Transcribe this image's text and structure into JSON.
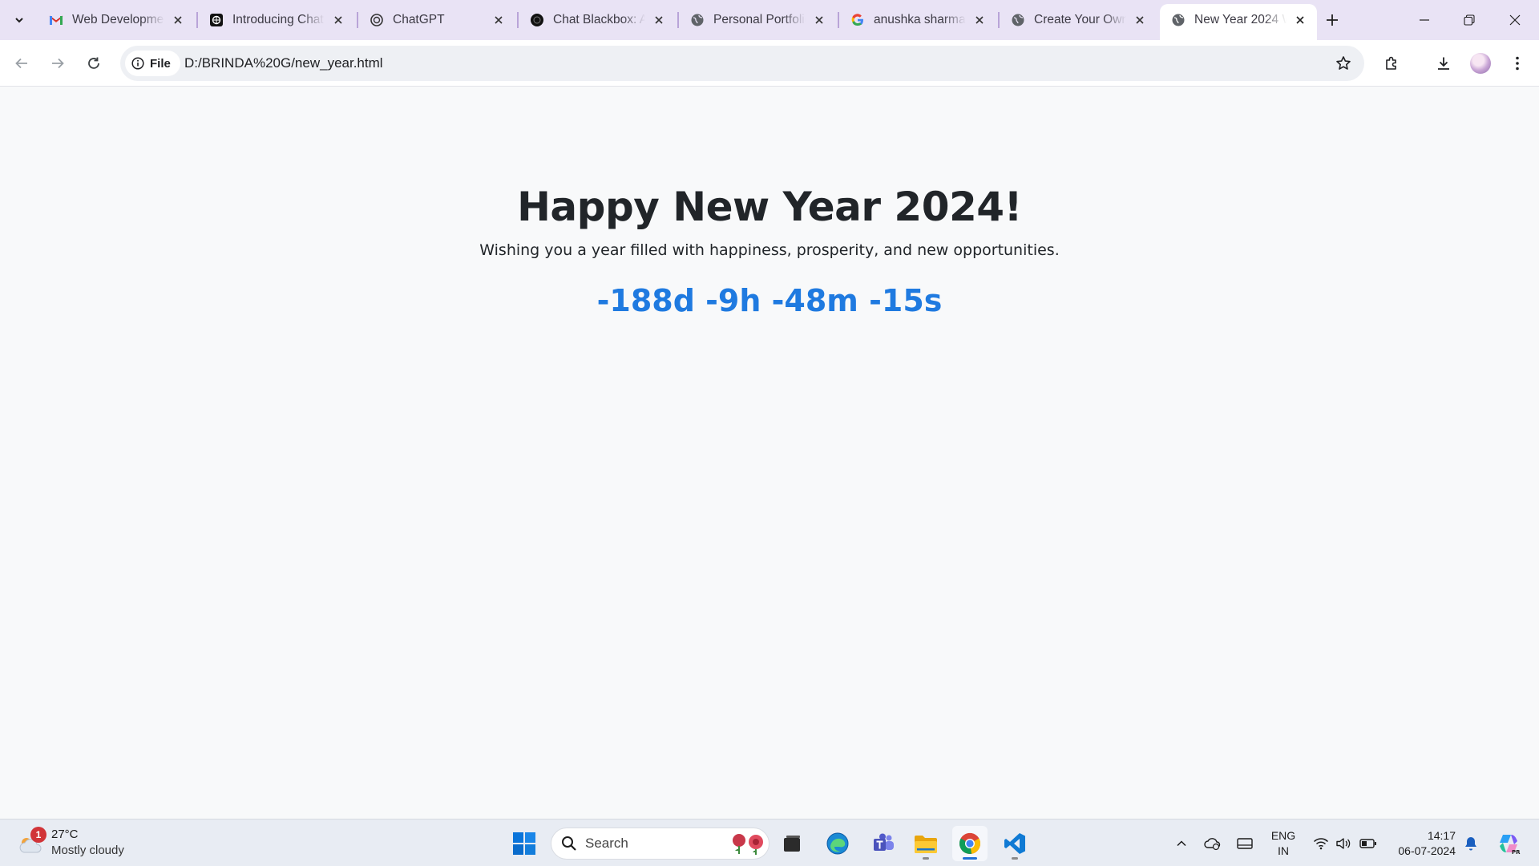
{
  "browser": {
    "tabs": [
      {
        "title": "Web Developme",
        "icon": "gmail-icon",
        "active": false
      },
      {
        "title": "Introducing Chat",
        "icon": "openai-icon",
        "active": false
      },
      {
        "title": "ChatGPT",
        "icon": "openai-icon",
        "active": false
      },
      {
        "title": "Chat Blackbox: A",
        "icon": "blackbox-icon",
        "active": false
      },
      {
        "title": "Personal Portfolio",
        "icon": "globe-icon",
        "active": false
      },
      {
        "title": "anushka sharma",
        "icon": "google-icon",
        "active": false
      },
      {
        "title": "Create Your Own",
        "icon": "globe-icon",
        "active": false
      },
      {
        "title": "New Year 2024 W",
        "icon": "globe-icon",
        "active": true
      }
    ],
    "site_chip_label": "File",
    "url": "D:/BRINDA%20G/new_year.html"
  },
  "page": {
    "heading": "Happy New Year 2024!",
    "subtitle": "Wishing you a year filled with happiness, prosperity, and new opportunities.",
    "countdown": "-188d -9h -48m -15s"
  },
  "taskbar": {
    "weather": {
      "temp": "27°C",
      "desc": "Mostly cloudy",
      "badge": "1"
    },
    "search_placeholder": "Search",
    "lang": {
      "line1": "ENG",
      "line2": "IN"
    },
    "clock": {
      "time": "14:17",
      "date": "06-07-2024"
    }
  },
  "colors": {
    "tabstrip": "#e9e3f5",
    "countdown": "#1f7ae0",
    "heading": "#212529"
  }
}
